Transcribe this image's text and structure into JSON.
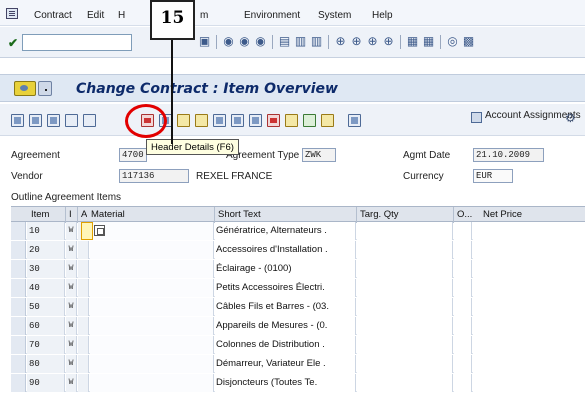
{
  "menu": {
    "items": [
      "Contract",
      "Edit",
      "H",
      "m",
      "Environment",
      "System",
      "Help"
    ]
  },
  "callout": {
    "number": "15"
  },
  "title": "Change Contract : Item Overview",
  "app_toolbar": {
    "account_assignments": "Account Assignments"
  },
  "tooltip": "Header Details  (F6)",
  "header": {
    "agreement_label": "Agreement",
    "agreement_value": "4700",
    "agreement_type_label": "Agreement Type",
    "agreement_type_value": "ZWK",
    "agmt_date_label": "Agmt Date",
    "agmt_date_value": "21.10.2009",
    "vendor_label": "Vendor",
    "vendor_value": "117136",
    "vendor_name": "REXEL FRANCE",
    "currency_label": "Currency",
    "currency_value": "EUR"
  },
  "table": {
    "section_label": "Outline Agreement Items",
    "columns": [
      "Item",
      "I",
      "A",
      "Material",
      "Short Text",
      "Targ. Qty",
      "O...",
      "Net Price"
    ],
    "rows": [
      {
        "item": "10",
        "i": "W",
        "short_text": "Génératrice, Alternateurs ."
      },
      {
        "item": "20",
        "i": "W",
        "short_text": "Accessoires d'Installation ."
      },
      {
        "item": "30",
        "i": "W",
        "short_text": "Éclairage - (0100)"
      },
      {
        "item": "40",
        "i": "W",
        "short_text": "Petits Accessoires Électri."
      },
      {
        "item": "50",
        "i": "W",
        "short_text": "Câbles Fils et Barres - (03."
      },
      {
        "item": "60",
        "i": "W",
        "short_text": "Appareils de Mesures - (0."
      },
      {
        "item": "70",
        "i": "W",
        "short_text": "Colonnes de Distribution ."
      },
      {
        "item": "80",
        "i": "W",
        "short_text": "Démarreur, Variateur Ele ."
      },
      {
        "item": "90",
        "i": "W",
        "short_text": "Disjoncteurs (Toutes Te."
      }
    ]
  },
  "colors": {
    "title_text": "#0d2a6a",
    "callout_ring": "#e20000",
    "tooltip_bg": "#ffffe1"
  }
}
